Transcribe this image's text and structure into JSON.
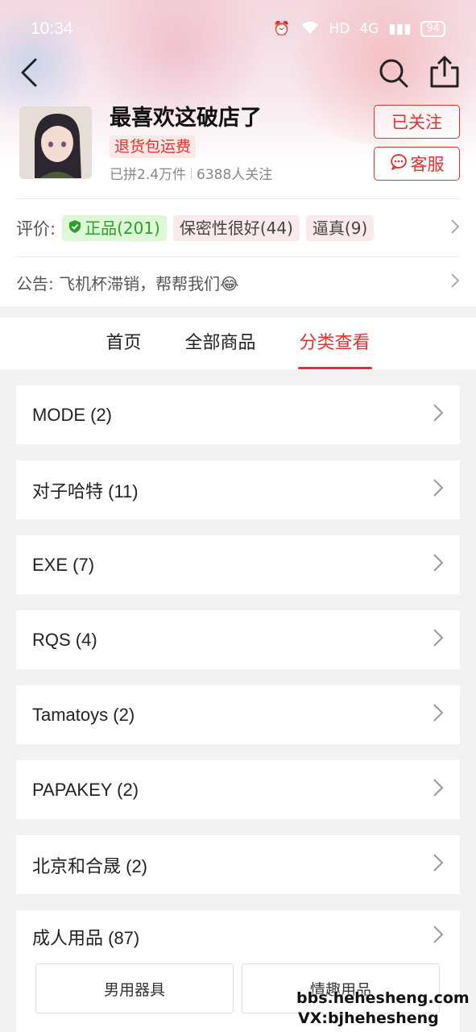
{
  "status_bar": {
    "time": "10:34",
    "network": "HD",
    "signal": "4G",
    "battery": "94"
  },
  "store": {
    "name": "最喜欢这破店了",
    "tag": "退货包运费",
    "sold": "已拼2.4万件",
    "followers": "6388人关注",
    "follow_button": "已关注",
    "service_button": "客服"
  },
  "reviews": {
    "label": "评价:",
    "tags": [
      {
        "label": "正品(201)"
      },
      {
        "label": "保密性很好(44)"
      },
      {
        "label": "逼真(9)"
      }
    ]
  },
  "notice": {
    "text": "公告: 飞机杯滞销，帮帮我们😂"
  },
  "tabs": [
    {
      "label": "首页"
    },
    {
      "label": "全部商品"
    },
    {
      "label": "分类查看",
      "active": true
    }
  ],
  "categories": [
    {
      "label": "MODE (2)"
    },
    {
      "label": "对子哈特 (11)"
    },
    {
      "label": "EXE (7)"
    },
    {
      "label": "RQS (4)"
    },
    {
      "label": "Tamatoys (2)"
    },
    {
      "label": "PAPAKEY (2)"
    },
    {
      "label": "北京和合晟 (2)"
    }
  ],
  "expanded_category": {
    "label": "成人用品 (87)",
    "subcategories": [
      {
        "label": "男用器具"
      },
      {
        "label": "情趣用品"
      }
    ]
  },
  "watermark": {
    "line1": "bbs.hehesheng.com",
    "line2": "VX:bjhehesheng"
  },
  "colors": {
    "accent": "#e0322e",
    "genuine_green": "#2aa12a"
  }
}
